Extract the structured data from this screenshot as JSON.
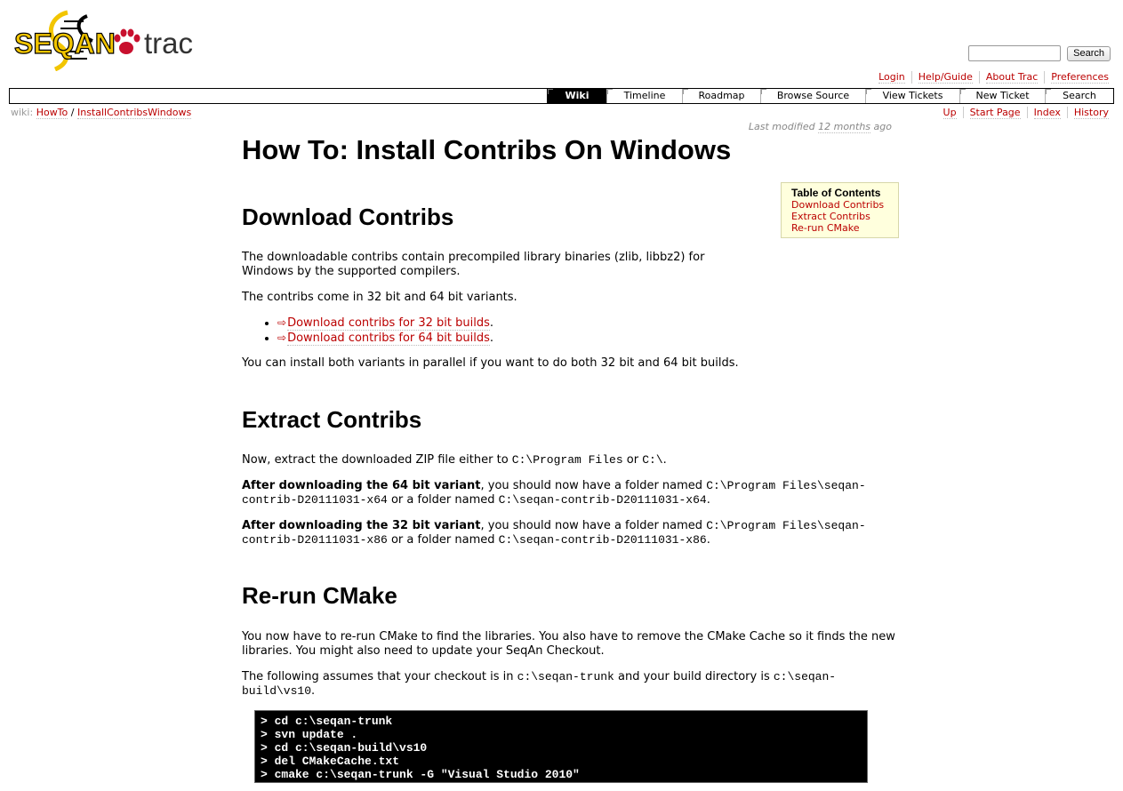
{
  "logo": {
    "text_part1": "SEQAN",
    "text_part2": "trac"
  },
  "search": {
    "placeholder": "",
    "button_label": "Search"
  },
  "metanav": [
    "Login",
    "Help/Guide",
    "About Trac",
    "Preferences"
  ],
  "mainnav": [
    {
      "label": "Wiki",
      "active": true
    },
    {
      "label": "Timeline"
    },
    {
      "label": "Roadmap"
    },
    {
      "label": "Browse Source"
    },
    {
      "label": "View Tickets"
    },
    {
      "label": "New Ticket"
    },
    {
      "label": "Search"
    }
  ],
  "wikipath": {
    "prefix": "wiki:",
    "parts": [
      "HowTo",
      "InstallContribsWindows"
    ],
    "separator": "/"
  },
  "ctxtnav": [
    "Up",
    "Start Page",
    "Index",
    "History"
  ],
  "lastmod": {
    "prefix": "Last modified",
    "age": "12 months",
    "suffix": "ago"
  },
  "page": {
    "title": "How To: Install Contribs On Windows",
    "toc": {
      "title": "Table of Contents",
      "items": [
        "Download Contribs",
        "Extract Contribs",
        "Re-run CMake"
      ]
    },
    "section1": {
      "heading": "Download Contribs",
      "p1": "The downloadable contribs contain precompiled library binaries (zlib, libbz2) for Windows by the supported compilers.",
      "p2": "The contribs come in 32 bit and 64 bit variants.",
      "links": [
        "Download contribs for 32 bit builds",
        "Download contribs for 64 bit builds"
      ],
      "p3": "You can install both variants in parallel if you want to do both 32 bit and 64 bit builds."
    },
    "section2": {
      "heading": "Extract Contribs",
      "p1_text": "Now, extract the downloaded ZIP file either to",
      "p1_code1": "C:\\Program Files",
      "p1_or": "or",
      "p1_code2": "C:\\",
      "p2_bold": "After downloading the 64 bit variant",
      "p2_text1": ", you should now have a folder named",
      "p2_code1": "C:\\Program Files\\seqan-contrib-D20111031-x64",
      "p2_text2": "or a folder named",
      "p2_code2": "C:\\seqan-contrib-D20111031-x64",
      "p3_bold": "After downloading the 32 bit variant",
      "p3_text1": ", you should now have a folder named",
      "p3_code1": "C:\\Program Files\\seqan-contrib-D20111031-x86",
      "p3_text2": "or a folder named",
      "p3_code2": "C:\\seqan-contrib-D20111031-x86"
    },
    "section3": {
      "heading": "Re-run CMake",
      "p1": "You now have to re-run CMake to find the libraries. You also have to remove the CMake Cache so it finds the new libraries. You might also need to update your SeqAn Checkout.",
      "p2_text1": "The following assumes that your checkout is in",
      "p2_code1": "c:\\seqan-trunk",
      "p2_text2": "and your build directory is",
      "p2_code2": "c:\\seqan-build\\vs10",
      "code_lines": [
        "> cd c:\\seqan-trunk",
        "> svn update .",
        "> cd c:\\seqan-build\\vs10",
        "> del CMakeCache.txt",
        "> cmake c:\\seqan-trunk -G \"Visual Studio 2010\""
      ]
    }
  },
  "colors": {
    "link": "#bb0000",
    "toc_bg": "#ffffdd",
    "logo_yellow": "#f2c500",
    "logo_red": "#c8102e"
  }
}
